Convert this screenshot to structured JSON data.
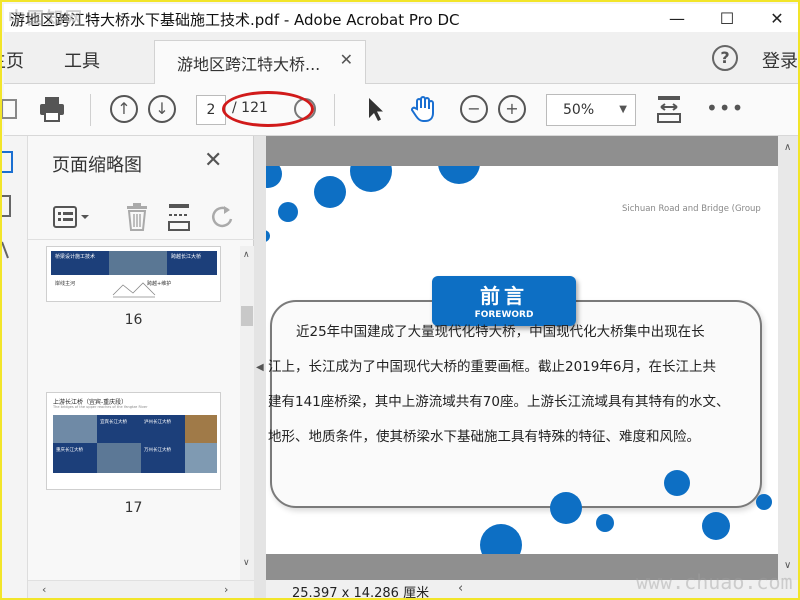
{
  "titlebar": {
    "title": "游地区跨江特大桥水下基础施工技术.pdf - Adobe Acrobat Pro DC",
    "watermark": "中国知网"
  },
  "tabbar": {
    "home": "主页",
    "tools": "工具",
    "doc_tab": "游地区跨江特大桥...",
    "login": "登录"
  },
  "toolbar": {
    "current_page": "2",
    "page_count": "/ 121",
    "zoom": "50%"
  },
  "panel": {
    "title": "页面缩略图",
    "thumbnails": [
      {
        "page": "16",
        "cap1": "桥梁设计施工技术",
        "cap2": "跨越长江大桥",
        "cap3": "岸线主河",
        "cap4": "跨越+维护"
      },
      {
        "page": "17",
        "heading": "上游长江桥（宜宾-重庆段）",
        "sub": "The bridges of the upper reaches of the Yangtze River",
        "cap1": "宜宾长江大桥",
        "cap2": "泸州长江大桥",
        "cap3": "重庆长江大桥",
        "cap4": "万州长江大桥"
      }
    ]
  },
  "slide": {
    "brand": "Sichuan Road and Bridge (Group",
    "heading": "前言",
    "heading_en": "FOREWORD",
    "paragraph": "近25年中国建成了大量现代化特大桥，中国现代化大桥集中出现在长\n江上，长江成为了中国现代大桥的重要画框。截止2019年6月，在长江上共\n建有141座桥梁，其中上游流域共有70座。上游长江流域具有其特有的水文、\n地形、地质条件，使其桥梁水下基础施工具有特殊的特征、难度和风险。"
  },
  "status": {
    "page_size": "25.397 x 14.286 厘米"
  },
  "bottom_watermark": "www.chuao.com",
  "colors": {
    "accent_blue": "#0d6fc4",
    "annotation_red": "#d11a1a",
    "frame_yellow": "#f2e52a"
  }
}
